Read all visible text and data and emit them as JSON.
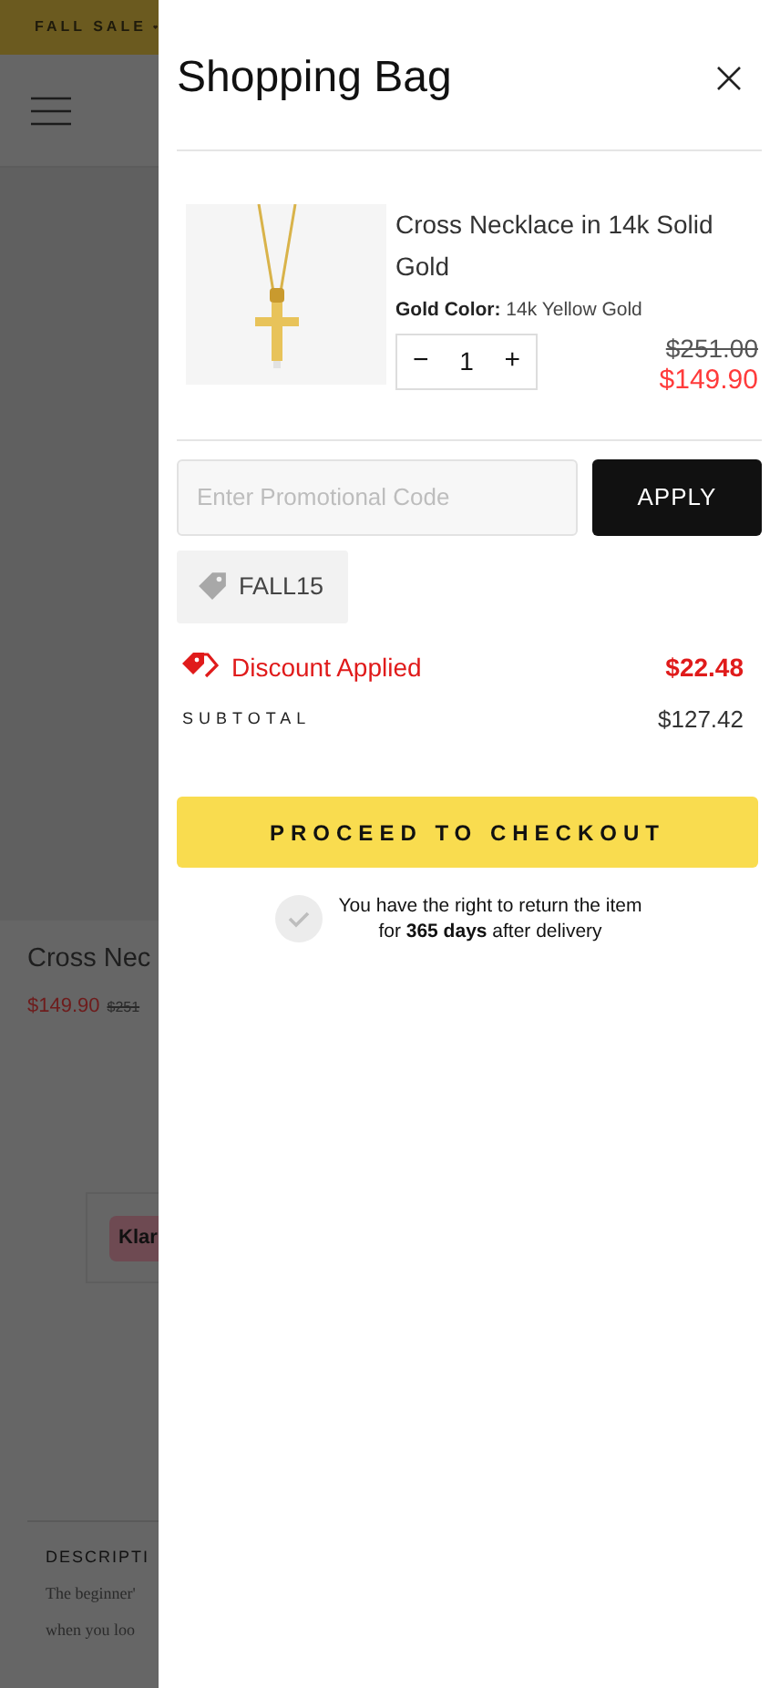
{
  "background_page": {
    "banner": "FALL SALE",
    "product_title": "Cross Nec",
    "price": "$149.90",
    "old_price": "$251",
    "klarna_badge": "Klar",
    "description_heading": "DESCRIPTI",
    "description_lines": [
      "The beginner'",
      "when you loo"
    ]
  },
  "drawer": {
    "title": "Shopping Bag",
    "items": [
      {
        "name": "Cross Necklace in 14k Solid Gold",
        "option_label": "Gold Color:",
        "option_value": "14k Yellow Gold",
        "quantity": "1",
        "decrement": "−",
        "increment": "+",
        "old_price": "$251.00",
        "price": "$149.90"
      }
    ],
    "promo": {
      "placeholder": "Enter Promotional Code",
      "button": "APPLY"
    },
    "applied_codes": [
      {
        "code": "FALL15"
      }
    ],
    "discount": {
      "label": "Discount Applied",
      "amount": "$22.48"
    },
    "subtotal": {
      "label": "SUBTOTAL",
      "amount": "$127.42"
    },
    "checkout": "PROCEED TO CHECKOUT",
    "return_note": {
      "checked": true,
      "line_1": "You have the right to return the item",
      "line_2": "for **365 days** after delivery"
    }
  }
}
